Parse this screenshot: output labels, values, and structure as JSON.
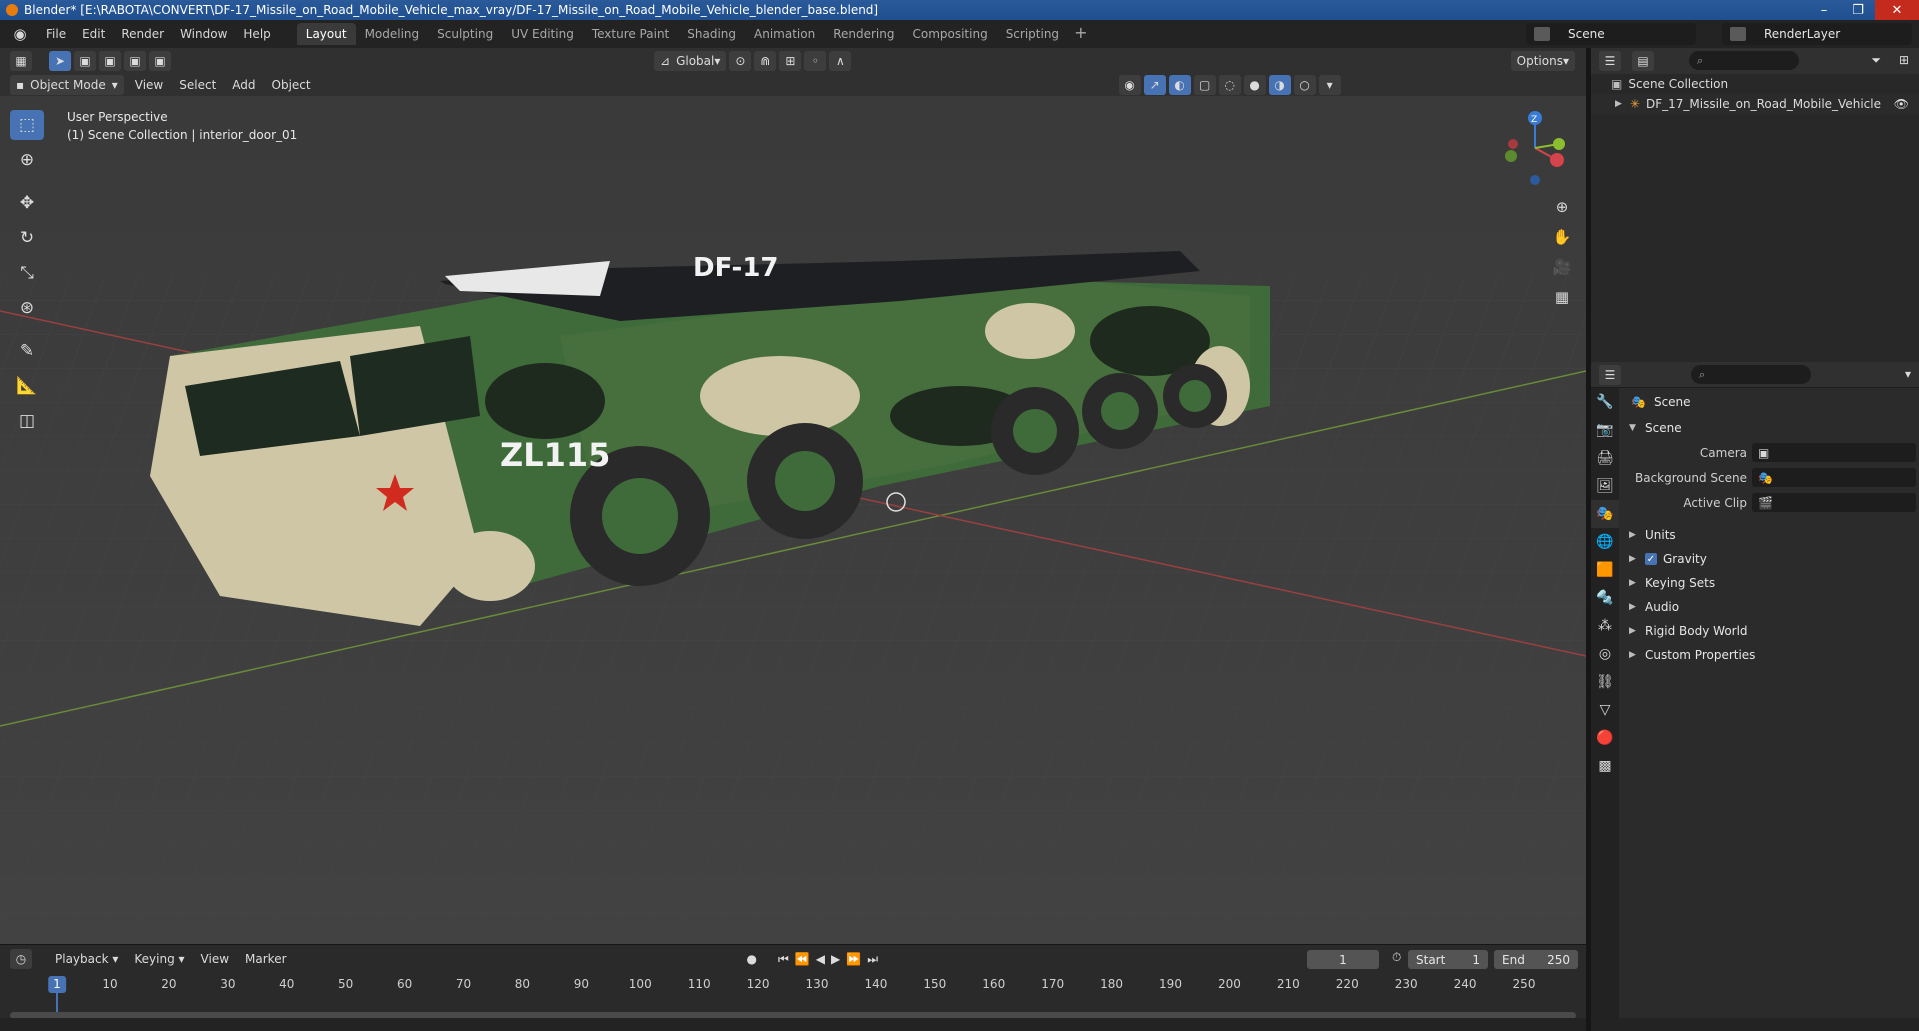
{
  "window": {
    "title": "Blender* [E:\\RABOTA\\CONVERT\\DF-17_Missile_on_Road_Mobile_Vehicle_max_vray/DF-17_Missile_on_Road_Mobile_Vehicle_blender_base.blend]"
  },
  "menu": [
    "File",
    "Edit",
    "Render",
    "Window",
    "Help"
  ],
  "workspaces": [
    "Layout",
    "Modeling",
    "Sculpting",
    "UV Editing",
    "Texture Paint",
    "Shading",
    "Animation",
    "Rendering",
    "Compositing",
    "Scripting"
  ],
  "workspace_active": "Layout",
  "scene_selector": "Scene",
  "layer_selector": "RenderLayer",
  "viewport_header": {
    "transform_orientation": "Global",
    "options_label": "Options",
    "mode": "Object Mode",
    "menus": [
      "View",
      "Select",
      "Add",
      "Object"
    ]
  },
  "viewport": {
    "perspective": "User Perspective",
    "context": "(1) Scene Collection | interior_door_01",
    "missile_label": "DF-17",
    "truck_label": "ZL115",
    "gizmo_z": "Z"
  },
  "outliner": {
    "root": "Scene Collection",
    "items": [
      "DF_17_Missile_on_Road_Mobile_Vehicle"
    ]
  },
  "properties": {
    "context": "Scene",
    "panel_title": "Scene",
    "fields": [
      {
        "label": "Camera",
        "value": ""
      },
      {
        "label": "Background Scene",
        "value": ""
      },
      {
        "label": "Active Clip",
        "value": ""
      }
    ],
    "subpanels": [
      "Units",
      "Gravity",
      "Keying Sets",
      "Audio",
      "Rigid Body World",
      "Custom Properties"
    ],
    "gravity_checked": true
  },
  "timeline": {
    "menus": [
      "Playback",
      "Keying",
      "View",
      "Marker"
    ],
    "current_frame": "1",
    "start_label": "Start",
    "start": "1",
    "end_label": "End",
    "end": "250",
    "ticks": [
      "1",
      "10",
      "20",
      "30",
      "40",
      "50",
      "60",
      "70",
      "80",
      "90",
      "100",
      "110",
      "120",
      "130",
      "140",
      "150",
      "160",
      "170",
      "180",
      "190",
      "200",
      "210",
      "220",
      "230",
      "240",
      "250"
    ]
  },
  "colors": {
    "accent": "#4772b3",
    "camo_green": "#3f6b3a",
    "camo_dark": "#1f2a1e",
    "camo_light": "#cfc6a6"
  }
}
